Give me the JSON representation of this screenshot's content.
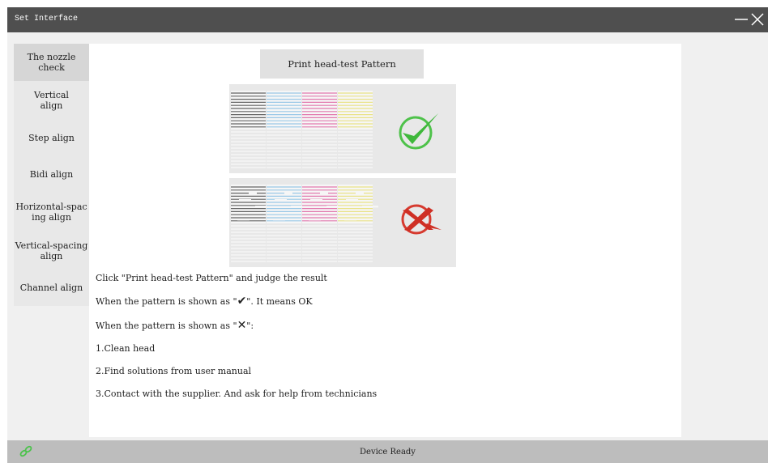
{
  "window": {
    "title": "Set Interface",
    "minimize_icon": "minimize-icon",
    "close_icon": "close-icon"
  },
  "sidebar": {
    "items": [
      {
        "label": "The nozzle check",
        "active": true
      },
      {
        "label": "Vertical align"
      },
      {
        "label": "Step align"
      },
      {
        "label": "Bidi align"
      },
      {
        "label": "Horizontal-spacing align"
      },
      {
        "label": "Vertical-spacing align"
      },
      {
        "label": "Channel align"
      }
    ]
  },
  "main": {
    "print_button": "Print head-test Pattern",
    "pattern_ok_icon": "check-mark-icon",
    "pattern_bad_icon": "x-mark-icon",
    "ink_colors": [
      "#555555",
      "#8fc3e6",
      "#e06aa6",
      "#e8e07a"
    ],
    "instructions": {
      "intro": "Click \"Print head-test Pattern\" and judge the result",
      "ok_prefix": "When the pattern is shown as \"",
      "ok_glyph": "✔",
      "ok_suffix": "\". It means OK",
      "bad_prefix": "When the pattern is shown as \"",
      "bad_glyph": "✕",
      "bad_suffix": "\":",
      "step1": "1.Clean head",
      "step2": "2.Find solutions from user manual",
      "step3": "3.Contact with the supplier. And ask for help from technicians"
    }
  },
  "status": {
    "text": "Device Ready",
    "icon": "link-icon",
    "icon_color": "#4cc24c"
  }
}
